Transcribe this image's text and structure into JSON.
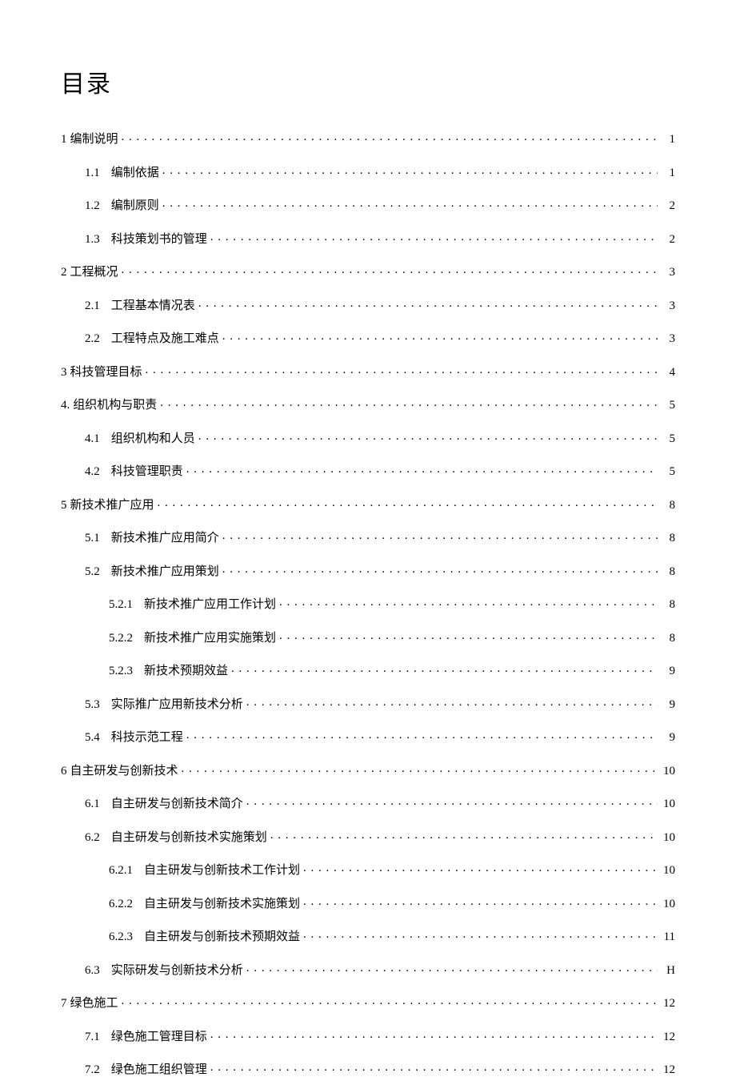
{
  "title": "目录",
  "toc": [
    {
      "level": 1,
      "num": "1",
      "label": "编制说明",
      "page": "1"
    },
    {
      "level": 2,
      "num": "1.1",
      "label": "编制依据",
      "page": "1"
    },
    {
      "level": 2,
      "num": "1.2",
      "label": "编制原则",
      "page": "2"
    },
    {
      "level": 2,
      "num": "1.3",
      "label": "科技策划书的管理",
      "page": "2"
    },
    {
      "level": 1,
      "num": "2",
      "label": "工程概况",
      "page": "3"
    },
    {
      "level": 2,
      "num": "2.1",
      "label": "工程基本情况表",
      "page": "3"
    },
    {
      "level": 2,
      "num": "2.2",
      "label": "工程特点及施工难点",
      "page": "3"
    },
    {
      "level": 1,
      "num": "3",
      "label": "科技管理目标",
      "page": "4"
    },
    {
      "level": 1,
      "num": "4.",
      "label": "组织机构与职责",
      "page": "5"
    },
    {
      "level": 2,
      "num": "4.1",
      "label": "组织机构和人员",
      "page": "5"
    },
    {
      "level": 2,
      "num": "4.2",
      "label": "科技管理职责",
      "page": "5"
    },
    {
      "level": 1,
      "num": "5",
      "label": "新技术推广应用",
      "page": "8"
    },
    {
      "level": 2,
      "num": "5.1",
      "label": "新技术推广应用简介",
      "page": "8"
    },
    {
      "level": 2,
      "num": "5.2",
      "label": "新技术推广应用策划",
      "page": "8"
    },
    {
      "level": 3,
      "num": "5.2.1",
      "label": "新技术推广应用工作计划",
      "page": "8"
    },
    {
      "level": 3,
      "num": "5.2.2",
      "label": "新技术推广应用实施策划",
      "page": "8"
    },
    {
      "level": 3,
      "num": "5.2.3",
      "label": "新技术预期效益",
      "page": "9"
    },
    {
      "level": 2,
      "num": "5.3",
      "label": "实际推广应用新技术分析",
      "page": "9"
    },
    {
      "level": 2,
      "num": "5.4",
      "label": "科技示范工程",
      "page": "9"
    },
    {
      "level": 1,
      "num": "6",
      "label": "自主研发与创新技术",
      "page": "10"
    },
    {
      "level": 2,
      "num": "6.1",
      "label": "自主研发与创新技术简介",
      "page": "10"
    },
    {
      "level": 2,
      "num": "6.2",
      "label": "自主研发与创新技术实施策划",
      "page": "10"
    },
    {
      "level": 3,
      "num": "6.2.1",
      "label": "自主研发与创新技术工作计划",
      "page": "10"
    },
    {
      "level": 3,
      "num": "6.2.2",
      "label": "自主研发与创新技术实施策划",
      "page": "10"
    },
    {
      "level": 3,
      "num": "6.2.3",
      "label": "自主研发与创新技术预期效益",
      "page": "11"
    },
    {
      "level": 2,
      "num": "6.3",
      "label": "实际研发与创新技术分析",
      "page": "H"
    },
    {
      "level": 1,
      "num": "7",
      "label": "绿色施工",
      "page": "12"
    },
    {
      "level": 2,
      "num": "7.1",
      "label": "绿色施工管理目标",
      "page": "12"
    },
    {
      "level": 2,
      "num": "7.2",
      "label": "绿色施工组织管理",
      "page": "12"
    }
  ]
}
